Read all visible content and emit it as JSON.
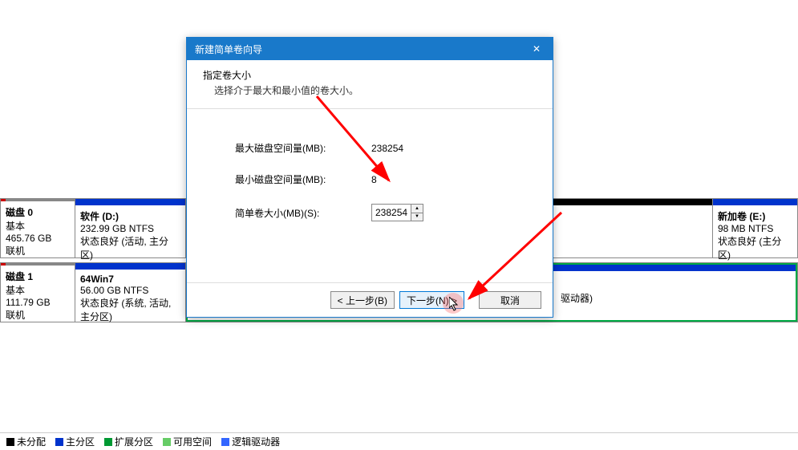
{
  "dialog": {
    "title": "新建简单卷向导",
    "header_title": "指定卷大小",
    "header_subtitle": "选择介于最大和最小值的卷大小。",
    "max_space_label": "最大磁盘空间量(MB):",
    "max_space_value": "238254",
    "min_space_label": "最小磁盘空间量(MB):",
    "min_space_value": "8",
    "simple_size_label": "简单卷大小(MB)(S):",
    "simple_size_value": "238254",
    "btn_back": "< 上一步(B)",
    "btn_next": "下一步(N) >",
    "btn_cancel": "取消"
  },
  "disks": {
    "disk0": {
      "name": "磁盘 0",
      "type": "基本",
      "size": "465.76 GB",
      "status": "联机",
      "partitions": {
        "p1": {
          "title": "软件  (D:)",
          "size": "232.99 GB NTFS",
          "status": "状态良好 (活动, 主分区)"
        },
        "p2": {
          "title": "新加卷  (E:)",
          "size": "98 MB NTFS",
          "status": "状态良好 (主分区)"
        }
      }
    },
    "disk1": {
      "name": "磁盘 1",
      "type": "基本",
      "size": "111.79 GB",
      "status": "联机",
      "partitions": {
        "p1": {
          "title": "64Win7",
          "size": "56.00 GB NTFS",
          "status": "状态良好 (系统, 活动, 主分区)"
        },
        "p2_extra": "驱动器)"
      }
    }
  },
  "legend": {
    "unallocated": "未分配",
    "primary": "主分区",
    "extended": "扩展分区",
    "free": "可用空间",
    "logical": "逻辑驱动器"
  },
  "colors": {
    "black": "#000000",
    "blue": "#0033cc",
    "green": "#009933",
    "lightgreen": "#66cc66",
    "logical_blue": "#3366ff"
  }
}
